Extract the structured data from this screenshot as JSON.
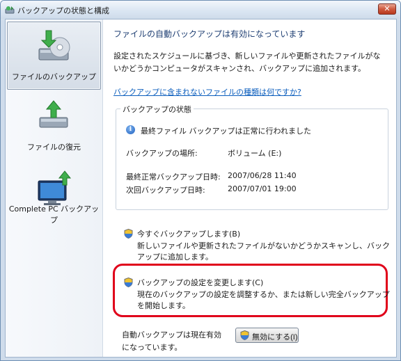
{
  "window": {
    "title": "バックアップの状態と構成",
    "close_glyph": "✕"
  },
  "nav": {
    "items": [
      {
        "label": "ファイルのバックアップ",
        "icon": "backup-disk-icon",
        "selected": true
      },
      {
        "label": "ファイルの復元",
        "icon": "restore-drive-icon",
        "selected": false
      },
      {
        "label": "Complete PC バックアップ",
        "icon": "complete-pc-backup-icon",
        "selected": false
      }
    ]
  },
  "main": {
    "heading": "ファイルの自動バックアップは有効になっています",
    "description": "設定されたスケジュールに基づき、新しいファイルや更新されたファイルがないかどうかコンピュータがスキャンされ、バックアップに追加されます。",
    "link": "バックアップに含まれないファイルの種類は何ですか?",
    "status": {
      "group_title": "バックアップの状態",
      "info_icon_glyph": "i",
      "info_text": "最終ファイル バックアップは正常に行われました",
      "location_label": "バックアップの場所:",
      "location_value": "ボリューム (E:)",
      "last_label": "最終正常バックアップ日時:",
      "last_value": "2007/06/28 11:40",
      "next_label": "次回バックアップ日時:",
      "next_value": "2007/07/01 19:00"
    },
    "backup_now": {
      "title": "今すぐバックアップします(B)",
      "description": "新しいファイルや更新されたファイルがないかどうかスキャンし、バックアップに追加します。"
    },
    "change_settings": {
      "title": "バックアップの設定を変更します(C)",
      "description": "現在のバックアップの設定を調整するか、または新しい完全バックアップを開始します。"
    },
    "auto_status_text": "自動バックアップは現在有効になっています。",
    "disable_button": "無効にする(I)"
  },
  "colors": {
    "heading": "#1f3f73",
    "link": "#0a5dbd",
    "highlight": "#e0001a"
  }
}
